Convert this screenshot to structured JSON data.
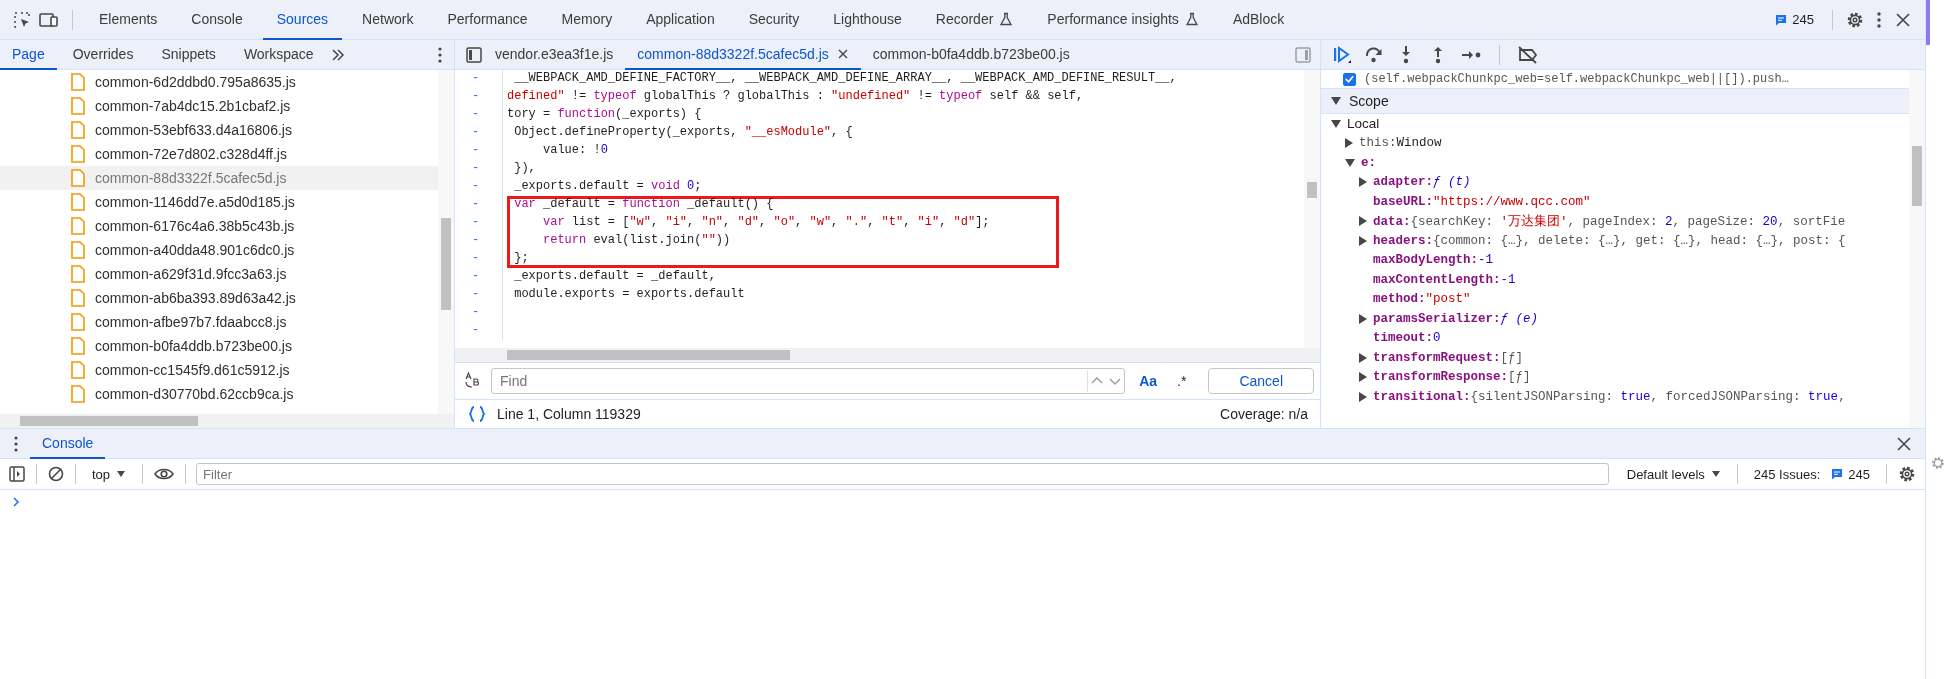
{
  "toolbar": {
    "tabs": [
      {
        "label": "Elements",
        "selected": false,
        "experimental": false
      },
      {
        "label": "Console",
        "selected": false,
        "experimental": false
      },
      {
        "label": "Sources",
        "selected": true,
        "experimental": false
      },
      {
        "label": "Network",
        "selected": false,
        "experimental": false
      },
      {
        "label": "Performance",
        "selected": false,
        "experimental": false
      },
      {
        "label": "Memory",
        "selected": false,
        "experimental": false
      },
      {
        "label": "Application",
        "selected": false,
        "experimental": false
      },
      {
        "label": "Security",
        "selected": false,
        "experimental": false
      },
      {
        "label": "Lighthouse",
        "selected": false,
        "experimental": false
      },
      {
        "label": "Recorder",
        "selected": false,
        "experimental": true
      },
      {
        "label": "Performance insights",
        "selected": false,
        "experimental": true
      },
      {
        "label": "AdBlock",
        "selected": false,
        "experimental": false
      }
    ],
    "issues": "245"
  },
  "navigator": {
    "tabs": [
      {
        "label": "Page",
        "selected": true
      },
      {
        "label": "Overrides",
        "selected": false
      },
      {
        "label": "Snippets",
        "selected": false
      },
      {
        "label": "Workspace",
        "selected": false
      }
    ],
    "files": [
      {
        "name": "common-6d2ddbd0.795a8635.js",
        "selected": false
      },
      {
        "name": "common-7ab4dc15.2b1cbaf2.js",
        "selected": false
      },
      {
        "name": "common-53ebf633.d4a16806.js",
        "selected": false
      },
      {
        "name": "common-72e7d802.c328d4ff.js",
        "selected": false
      },
      {
        "name": "common-88d3322f.5cafec5d.js",
        "selected": true
      },
      {
        "name": "common-1146dd7e.a5d0d185.js",
        "selected": false
      },
      {
        "name": "common-6176c4a6.38b5c43b.js",
        "selected": false
      },
      {
        "name": "common-a40dda48.901c6dc0.js",
        "selected": false
      },
      {
        "name": "common-a629f31d.9fcc3a63.js",
        "selected": false
      },
      {
        "name": "common-ab6ba393.89d63a42.js",
        "selected": false
      },
      {
        "name": "common-afbe97b7.fdaabcc8.js",
        "selected": false
      },
      {
        "name": "common-b0fa4ddb.b723be00.js",
        "selected": false
      },
      {
        "name": "common-cc1545f9.d61c5912.js",
        "selected": false
      },
      {
        "name": "common-d30770bd.62ccb9ca.js",
        "selected": false
      }
    ]
  },
  "editor": {
    "tabs": [
      {
        "label": "vendor.e3ea3f1e.js",
        "selected": false
      },
      {
        "label": "common-88d3322f.5cafec5d.js",
        "selected": true
      },
      {
        "label": "common-b0fa4ddb.b723be00.js",
        "selected": false
      }
    ],
    "lines": [
      {
        "marker": "-",
        "highlighted": false,
        "tokens": [
          {
            "text": " __WEBPACK_AMD_DEFINE_FACTORY__, __WEBPACK_AMD_DEFINE_ARRAY__, __WEBPACK_AMD_DEFINE_RESULT__,",
            "kind": "plain"
          }
        ]
      },
      {
        "marker": "-",
        "highlighted": false,
        "tokens": [
          {
            "text": "defined\"",
            "kind": "string"
          },
          {
            "text": " != ",
            "kind": "plain"
          },
          {
            "text": "typeof",
            "kind": "keyword"
          },
          {
            "text": " globalThis ? globalThis : ",
            "kind": "plain"
          },
          {
            "text": "\"undefined\"",
            "kind": "string"
          },
          {
            "text": " != ",
            "kind": "plain"
          },
          {
            "text": "typeof",
            "kind": "keyword"
          },
          {
            "text": " self && self,",
            "kind": "plain"
          }
        ]
      },
      {
        "marker": "-",
        "highlighted": false,
        "tokens": [
          {
            "text": "tory = ",
            "kind": "plain"
          },
          {
            "text": "function",
            "kind": "keyword"
          },
          {
            "text": "(_exports) {",
            "kind": "plain"
          }
        ]
      },
      {
        "marker": "-",
        "highlighted": false,
        "tokens": [
          {
            "text": " Object.defineProperty(_exports, ",
            "kind": "plain"
          },
          {
            "text": "\"__esModule\"",
            "kind": "string"
          },
          {
            "text": ", {",
            "kind": "plain"
          }
        ]
      },
      {
        "marker": "-",
        "highlighted": false,
        "tokens": [
          {
            "text": "     value: !",
            "kind": "plain"
          },
          {
            "text": "0",
            "kind": "number"
          }
        ]
      },
      {
        "marker": "-",
        "highlighted": false,
        "tokens": [
          {
            "text": " }),",
            "kind": "plain"
          }
        ]
      },
      {
        "marker": "-",
        "highlighted": false,
        "tokens": [
          {
            "text": " _exports.default = ",
            "kind": "plain"
          },
          {
            "text": "void",
            "kind": "keyword"
          },
          {
            "text": " 0",
            "kind": "number"
          },
          {
            "text": ";",
            "kind": "plain"
          }
        ]
      },
      {
        "marker": "-",
        "highlighted": true,
        "tokens": [
          {
            "text": " var",
            "kind": "keyword"
          },
          {
            "text": " _default = ",
            "kind": "plain"
          },
          {
            "text": "function",
            "kind": "keyword"
          },
          {
            "text": " _default() {",
            "kind": "plain"
          }
        ]
      },
      {
        "marker": "-",
        "highlighted": true,
        "tokens": [
          {
            "text": "     var",
            "kind": "keyword"
          },
          {
            "text": " list = [",
            "kind": "plain"
          },
          {
            "text": "\"w\"",
            "kind": "string"
          },
          {
            "text": ", ",
            "kind": "plain"
          },
          {
            "text": "\"i\"",
            "kind": "string"
          },
          {
            "text": ", ",
            "kind": "plain"
          },
          {
            "text": "\"n\"",
            "kind": "string"
          },
          {
            "text": ", ",
            "kind": "plain"
          },
          {
            "text": "\"d\"",
            "kind": "string"
          },
          {
            "text": ", ",
            "kind": "plain"
          },
          {
            "text": "\"o\"",
            "kind": "string"
          },
          {
            "text": ", ",
            "kind": "plain"
          },
          {
            "text": "\"w\"",
            "kind": "string"
          },
          {
            "text": ", ",
            "kind": "plain"
          },
          {
            "text": "\".\"",
            "kind": "string"
          },
          {
            "text": ", ",
            "kind": "plain"
          },
          {
            "text": "\"t\"",
            "kind": "string"
          },
          {
            "text": ", ",
            "kind": "plain"
          },
          {
            "text": "\"i\"",
            "kind": "string"
          },
          {
            "text": ", ",
            "kind": "plain"
          },
          {
            "text": "\"d\"",
            "kind": "string"
          },
          {
            "text": "];",
            "kind": "plain"
          }
        ]
      },
      {
        "marker": "-",
        "highlighted": true,
        "tokens": [
          {
            "text": "     return",
            "kind": "keyword"
          },
          {
            "text": " eval(list.join(",
            "kind": "plain"
          },
          {
            "text": "\"\"",
            "kind": "string"
          },
          {
            "text": "))",
            "kind": "plain"
          }
        ]
      },
      {
        "marker": "-",
        "highlighted": true,
        "tokens": [
          {
            "text": " };",
            "kind": "plain"
          }
        ]
      },
      {
        "marker": "-",
        "highlighted": false,
        "tokens": [
          {
            "text": " _exports.default = _default,",
            "kind": "plain"
          }
        ]
      },
      {
        "marker": "-",
        "highlighted": false,
        "tokens": [
          {
            "text": " module.exports = exports.default",
            "kind": "plain"
          }
        ]
      },
      {
        "marker": "-",
        "highlighted": false
      },
      {
        "marker": "-",
        "highlighted": false
      }
    ],
    "find": {
      "placeholder": "Find",
      "match_case": "Aa",
      "regex": ".*",
      "cancel": "Cancel"
    },
    "status": {
      "position": "Line 1, Column 119329",
      "coverage": "Coverage: n/a"
    }
  },
  "debugger": {
    "breakpoint": {
      "text": "(self.webpackChunkpc_web=self.webpackChunkpc_web||[]).push…",
      "checked": true
    },
    "scope": {
      "title": "Scope",
      "expanded": true,
      "items": [
        {
          "key": "Local",
          "kind": "group",
          "expandable": true,
          "expanded": true,
          "children": [
            {
              "key": "this:",
              "kind": "variable",
              "expandable": true,
              "expanded": false,
              "tokens": [
                {
                  "text": "Window",
                  "kind": "object"
                }
              ]
            },
            {
              "key": "e:",
              "kind": "own",
              "expandable": true,
              "expanded": true,
              "children": [
                {
                  "key": "adapter:",
                  "kind": "own",
                  "expandable": true,
                  "expanded": false,
                  "tokens": [
                    {
                      "text": "ƒ (t)",
                      "kind": "func"
                    }
                  ]
                },
                {
                  "key": "baseURL:",
                  "kind": "own",
                  "expandable": false,
                  "tokens": [
                    {
                      "text": "\"https://www.qcc.com\"",
                      "kind": "string"
                    }
                  ]
                },
                {
                  "key": "data:",
                  "kind": "own",
                  "expandable": true,
                  "expanded": false,
                  "tokens": [
                    {
                      "text": "{searchKey: ",
                      "kind": "plain"
                    },
                    {
                      "text": "'万达集团'",
                      "kind": "string"
                    },
                    {
                      "text": ", pageIndex: ",
                      "kind": "plain"
                    },
                    {
                      "text": "2",
                      "kind": "number"
                    },
                    {
                      "text": ", pageSize: ",
                      "kind": "plain"
                    },
                    {
                      "text": "20",
                      "kind": "number"
                    },
                    {
                      "text": ", sortFie",
                      "kind": "plain"
                    }
                  ]
                },
                {
                  "key": "headers:",
                  "kind": "own",
                  "expandable": true,
                  "expanded": false,
                  "tokens": [
                    {
                      "text": "{common: {…}, delete: {…}, get: {…}, head: {…}, post: {",
                      "kind": "plain"
                    }
                  ]
                },
                {
                  "key": "maxBodyLength:",
                  "kind": "own",
                  "expandable": false,
                  "tokens": [
                    {
                      "text": "-1",
                      "kind": "number"
                    }
                  ]
                },
                {
                  "key": "maxContentLength:",
                  "kind": "own",
                  "expandable": false,
                  "tokens": [
                    {
                      "text": "-1",
                      "kind": "number"
                    }
                  ]
                },
                {
                  "key": "method:",
                  "kind": "own",
                  "expandable": false,
                  "tokens": [
                    {
                      "text": "\"post\"",
                      "kind": "string"
                    }
                  ]
                },
                {
                  "key": "paramsSerializer:",
                  "kind": "own",
                  "expandable": true,
                  "expanded": false,
                  "tokens": [
                    {
                      "text": "ƒ (e)",
                      "kind": "func"
                    }
                  ]
                },
                {
                  "key": "timeout:",
                  "kind": "own",
                  "expandable": false,
                  "tokens": [
                    {
                      "text": "0",
                      "kind": "number"
                    }
                  ]
                },
                {
                  "key": "transformRequest:",
                  "kind": "own",
                  "expandable": true,
                  "expanded": false,
                  "tokens": [
                    {
                      "text": "[ƒ]",
                      "kind": "plain"
                    }
                  ]
                },
                {
                  "key": "transformResponse:",
                  "kind": "own",
                  "expandable": true,
                  "expanded": false,
                  "tokens": [
                    {
                      "text": "[ƒ]",
                      "kind": "plain"
                    }
                  ]
                },
                {
                  "key": "transitional:",
                  "kind": "own",
                  "expandable": true,
                  "expanded": false,
                  "tokens": [
                    {
                      "text": "{silentJSONParsing: ",
                      "kind": "plain"
                    },
                    {
                      "text": "true",
                      "kind": "number"
                    },
                    {
                      "text": ", forcedJSONParsing: ",
                      "kind": "plain"
                    },
                    {
                      "text": "true",
                      "kind": "number"
                    },
                    {
                      "text": ",",
                      "kind": "plain"
                    }
                  ]
                }
              ]
            }
          ]
        }
      ]
    }
  },
  "drawer": {
    "tabs": [
      {
        "label": "Console",
        "selected": true
      }
    ],
    "context": "top",
    "filter_placeholder": "Filter",
    "levels": "Default levels",
    "issues_label": "245 Issues:",
    "issues_count": "245"
  }
}
